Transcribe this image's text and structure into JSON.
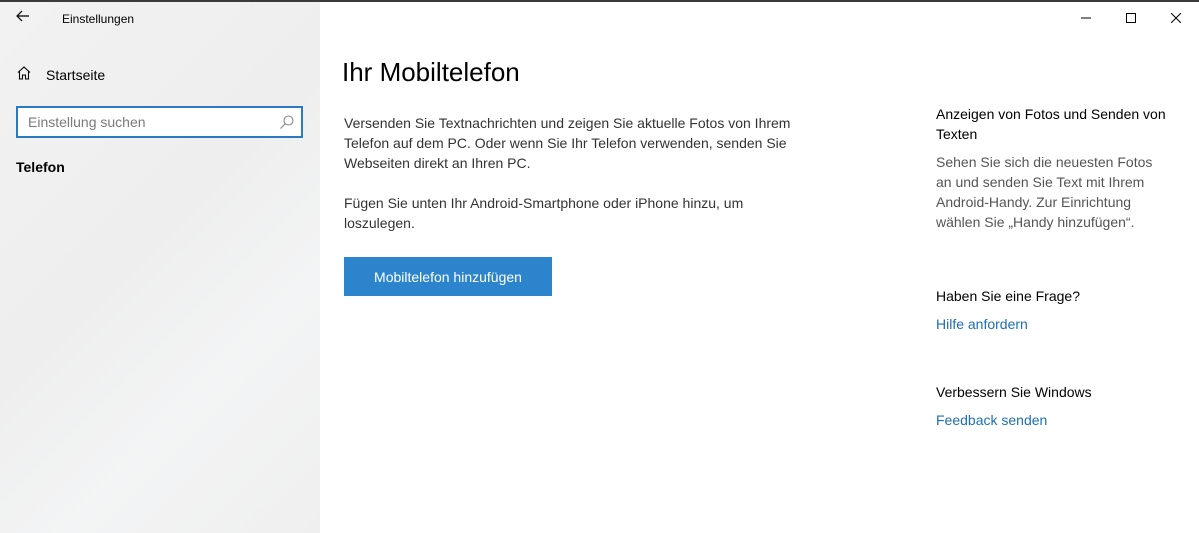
{
  "window": {
    "title": "Einstellungen",
    "controls": [
      "minimize-icon",
      "maximize-icon",
      "close-icon"
    ]
  },
  "sidebar": {
    "home_label": "Startseite",
    "search": {
      "placeholder": "Einstellung suchen",
      "value": ""
    },
    "section_label": "Telefon"
  },
  "main": {
    "title": "Ihr Mobiltelefon",
    "paragraphs": [
      "Versenden Sie Textnachrichten und zeigen Sie aktuelle Fotos von Ihrem Telefon auf dem PC. Oder wenn Sie Ihr Telefon verwenden, senden Sie Webseiten direkt an Ihren PC.",
      "Fügen Sie unten Ihr Android-Smartphone oder iPhone hinzu, um loszulegen."
    ],
    "add_button_label": "Mobiltelefon hinzufügen"
  },
  "aside": {
    "info": {
      "heading": "Anzeigen von Fotos und Senden von Texten",
      "text": "Sehen Sie sich die neuesten Fotos an und senden Sie Text mit Ihrem Android-Handy. Zur Einrichtung wählen Sie „Handy hinzufügen“."
    },
    "help": {
      "heading": "Haben Sie eine Frage?",
      "link": "Hilfe anfordern"
    },
    "feedback": {
      "heading": "Verbessern Sie Windows",
      "link": "Feedback senden"
    }
  },
  "colors": {
    "accent": "#2b84cc",
    "link": "#1f6fb3",
    "search_border": "#2b79c2",
    "sidebar_bg": "#f2f2f2"
  }
}
